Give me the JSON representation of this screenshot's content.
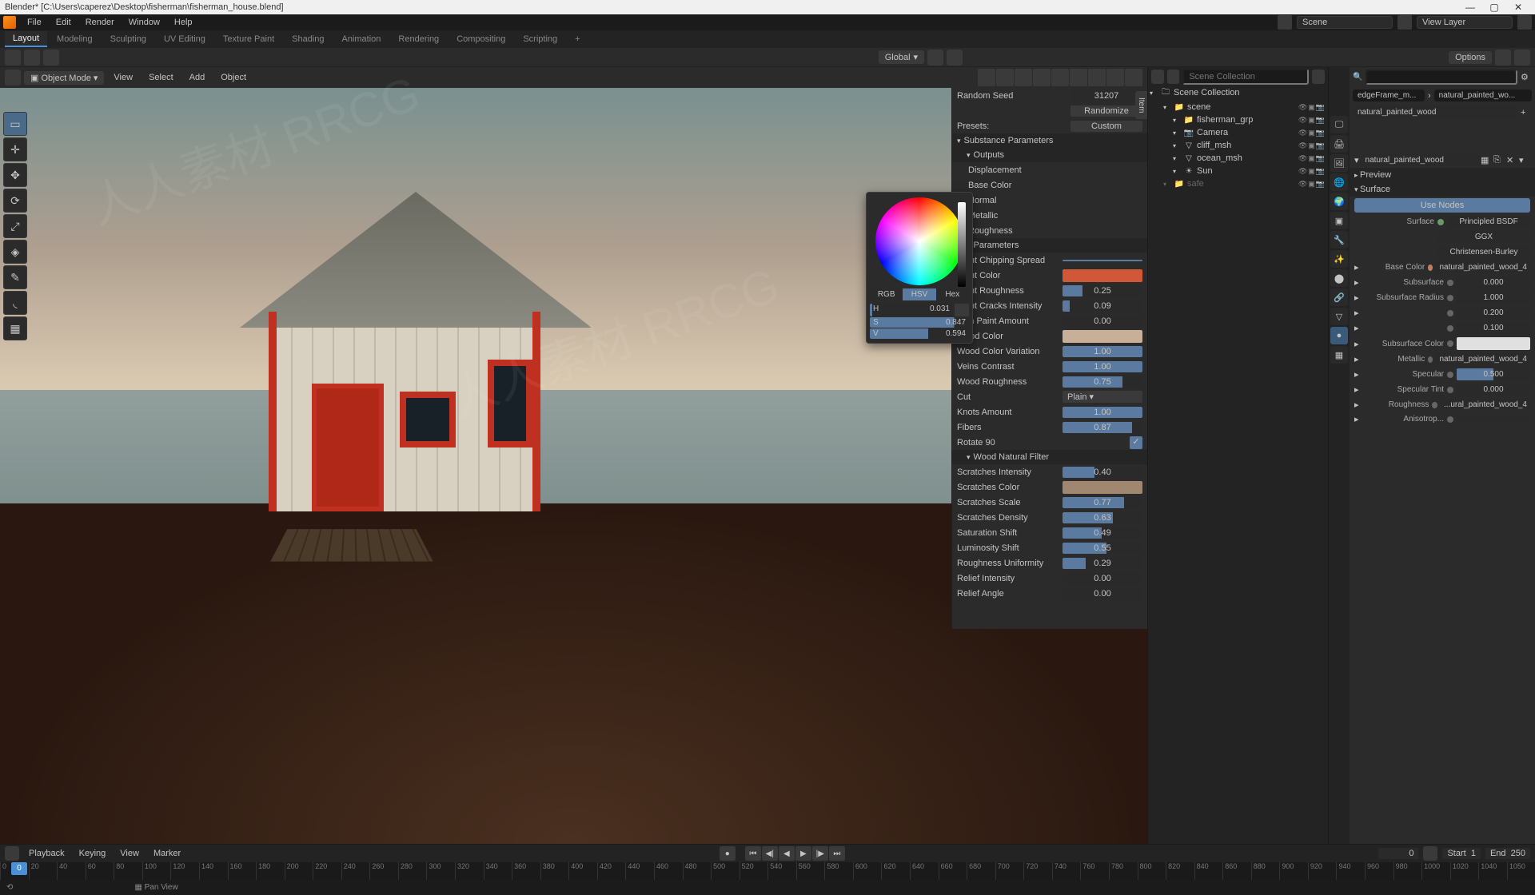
{
  "window": {
    "title": "Blender* [C:\\Users\\caperez\\Desktop\\fisherman\\fisherman_house.blend]",
    "min": "—",
    "max": "▢",
    "close": "✕"
  },
  "menus": [
    "File",
    "Edit",
    "Render",
    "Window",
    "Help"
  ],
  "workspaces": [
    "Layout",
    "Modeling",
    "Sculpting",
    "UV Editing",
    "Texture Paint",
    "Shading",
    "Animation",
    "Rendering",
    "Compositing",
    "Scripting",
    "+"
  ],
  "scene_label": "Scene",
  "viewlayer_label": "View Layer",
  "header": {
    "global": "Global"
  },
  "view_header": {
    "mode": "Object Mode",
    "menus": [
      "View",
      "Select",
      "Add",
      "Object"
    ],
    "options": "Options"
  },
  "npanel": {
    "tab": "Item",
    "random_seed_label": "Random Seed",
    "random_seed": "31207",
    "randomize": "Randomize",
    "presets_label": "Presets:",
    "presets": "Custom",
    "substance": "Substance Parameters",
    "outputs": "Outputs",
    "outputs_list": [
      "Displacement",
      "Base Color",
      "Normal",
      "Metallic",
      "Roughness"
    ],
    "parameters": "Parameters",
    "params": [
      {
        "label": "Paint Chipping Spread",
        "type": "slider",
        "value": "",
        "pct": 100
      },
      {
        "label": "Paint Color",
        "type": "swatch",
        "color": "#d05838"
      },
      {
        "label": "Paint Roughness",
        "type": "slider",
        "value": "0.25",
        "pct": 25
      },
      {
        "label": "Paint Cracks Intensity",
        "type": "slider",
        "value": "0.09",
        "pct": 9
      },
      {
        "label": "Thin Paint Amount",
        "type": "slider",
        "value": "0.00",
        "pct": 0
      },
      {
        "label": "Wood Color",
        "type": "swatch",
        "color": "#c8b098"
      },
      {
        "label": "Wood Color Variation",
        "type": "slider",
        "value": "1.00",
        "pct": 100
      },
      {
        "label": "Veins Contrast",
        "type": "slider",
        "value": "1.00",
        "pct": 100
      },
      {
        "label": "Wood Roughness",
        "type": "slider",
        "value": "0.75",
        "pct": 75
      },
      {
        "label": "Cut",
        "type": "dropdown",
        "value": "Plain"
      },
      {
        "label": "Knots Amount",
        "type": "slider",
        "value": "1.00",
        "pct": 100
      },
      {
        "label": "Fibers",
        "type": "slider",
        "value": "0.87",
        "pct": 87
      },
      {
        "label": "Rotate 90",
        "type": "check",
        "value": "✓"
      }
    ],
    "wood_filter": "Wood Natural Filter",
    "filter_params": [
      {
        "label": "Scratches Intensity",
        "value": "0.40",
        "pct": 40
      },
      {
        "label": "Scratches Color",
        "value": "",
        "pct": 0,
        "swatch": "#a08870"
      },
      {
        "label": "Scratches Scale",
        "value": "0.77",
        "pct": 77
      },
      {
        "label": "Scratches Density",
        "value": "0.63",
        "pct": 63
      },
      {
        "label": "Saturation Shift",
        "value": "0.49",
        "pct": 49
      },
      {
        "label": "Luminosity Shift",
        "value": "0.55",
        "pct": 55
      },
      {
        "label": "Roughness Uniformity",
        "value": "0.29",
        "pct": 29
      },
      {
        "label": "Relief Intensity",
        "value": "0.00",
        "pct": 0
      },
      {
        "label": "Relief Angle",
        "value": "0.00",
        "pct": 0
      }
    ]
  },
  "color_picker": {
    "tabs": [
      "RGB",
      "HSV",
      "Hex"
    ],
    "active_tab": 1,
    "h_label": "H",
    "h": "0.031",
    "h_pct": 3,
    "s_label": "S",
    "s": "0.847",
    "s_pct": 85,
    "v_label": "V",
    "v": "0.594",
    "v_pct": 59
  },
  "outliner": {
    "title": "Scene Collection",
    "items": [
      {
        "depth": 1,
        "icon": "📁",
        "text": "scene"
      },
      {
        "depth": 2,
        "icon": "📁",
        "text": "fisherman_grp"
      },
      {
        "depth": 2,
        "icon": "📷",
        "text": "Camera"
      },
      {
        "depth": 2,
        "icon": "▽",
        "text": "cliff_msh"
      },
      {
        "depth": 2,
        "icon": "▽",
        "text": "ocean_msh"
      },
      {
        "depth": 2,
        "icon": "☀",
        "text": "Sun"
      },
      {
        "depth": 1,
        "icon": "📁",
        "text": "safe",
        "disabled": true
      }
    ]
  },
  "props": {
    "breadcrumb1": "edgeFrame_m...",
    "breadcrumb2": "natural_painted_wo...",
    "slot": "natural_painted_wood",
    "material": "natural_painted_wood",
    "preview": "Preview",
    "surface": "Surface",
    "use_nodes": "Use Nodes",
    "surface_row": {
      "label": "Surface",
      "value": "Principled BSDF"
    },
    "dist1": "GGX",
    "dist2": "Christensen-Burley",
    "rows": [
      {
        "label": "Base Color",
        "value": "natural_painted_wood_4",
        "dot": "#c08060"
      },
      {
        "label": "Subsurface",
        "value": "0.000"
      },
      {
        "label": "Subsurface Radius",
        "value": "1.000"
      },
      {
        "label": "",
        "value": "0.200"
      },
      {
        "label": "",
        "value": "0.100"
      },
      {
        "label": "Subsurface Color",
        "value": "",
        "swatch": "#e0e0e0"
      },
      {
        "label": "Metallic",
        "value": "natural_painted_wood_4"
      },
      {
        "label": "Specular",
        "value": "0.500",
        "pct": 50
      },
      {
        "label": "Specular Tint",
        "value": "0.000"
      },
      {
        "label": "Roughness",
        "value": "...ural_painted_wood_4"
      },
      {
        "label": "Anisotrop...",
        "value": ""
      }
    ]
  },
  "timeline": {
    "menus": [
      "Playback",
      "Keying",
      "View",
      "Marker"
    ],
    "frame": "0",
    "start_label": "Start",
    "start": "1",
    "end_label": "End",
    "end": "250",
    "ticks": [
      "0",
      "20",
      "40",
      "60",
      "80",
      "100",
      "120",
      "140",
      "160",
      "180",
      "200",
      "220",
      "240",
      "260",
      "280",
      "300",
      "320",
      "340",
      "360",
      "380",
      "400",
      "420",
      "440",
      "460",
      "480",
      "500",
      "520",
      "540",
      "560",
      "580",
      "600",
      "620",
      "640",
      "660",
      "680",
      "700",
      "720",
      "740",
      "760",
      "780",
      "800",
      "820",
      "840",
      "860",
      "880",
      "900",
      "920",
      "940",
      "960",
      "980",
      "1000",
      "1020",
      "1040",
      "1050"
    ]
  },
  "status": {
    "left": "⟲",
    "panview": "Pan View"
  }
}
